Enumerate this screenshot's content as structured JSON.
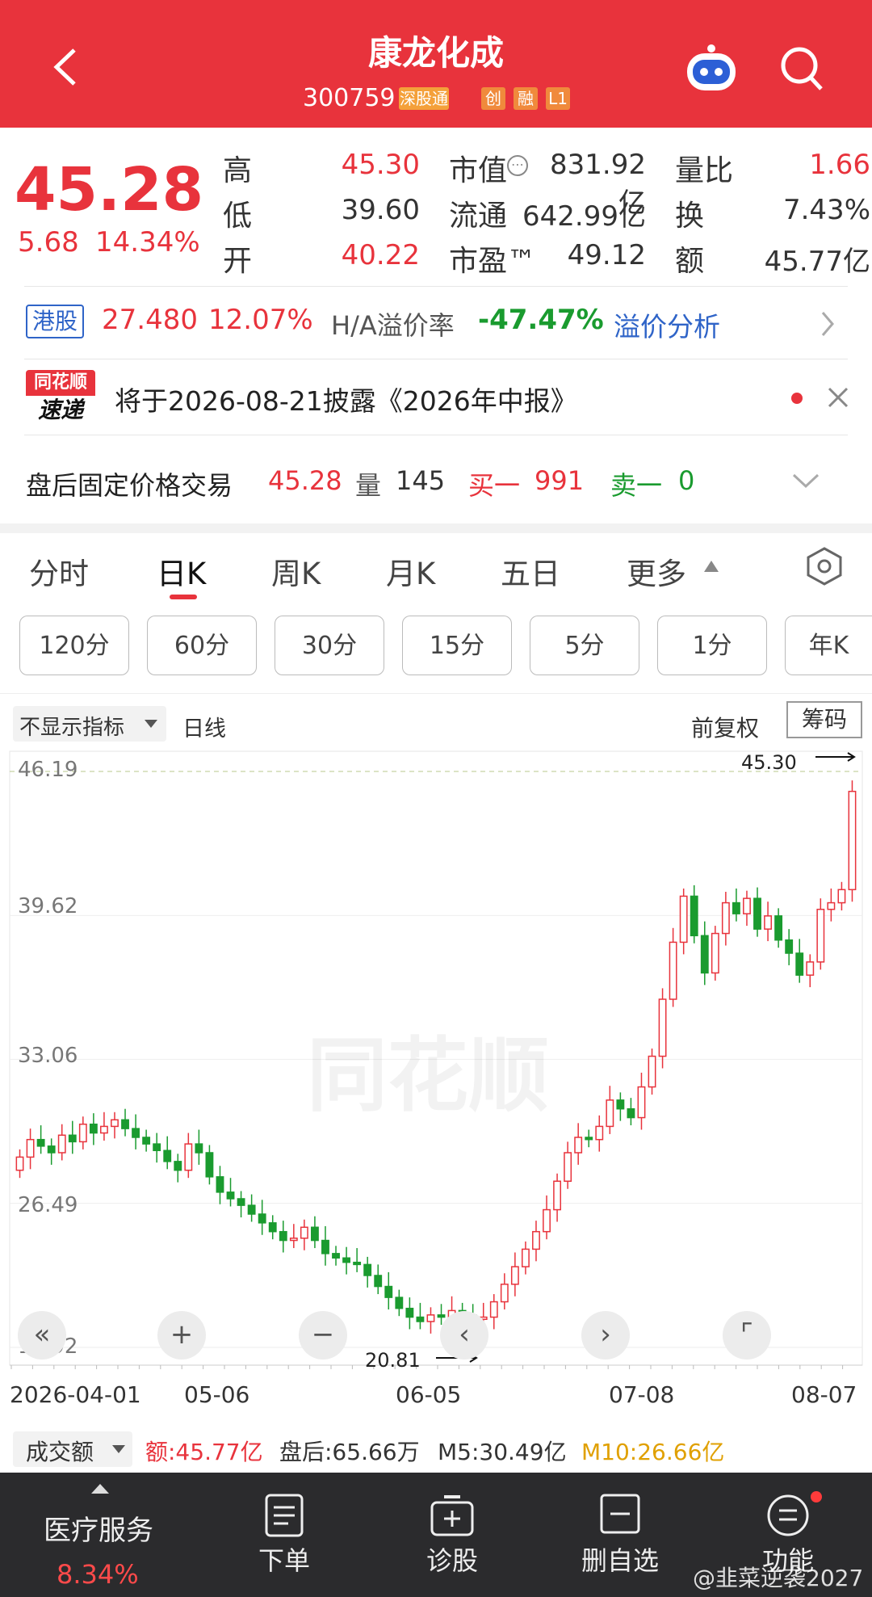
{
  "header": {
    "title": "康龙化成",
    "code": "300759",
    "tags": [
      "深股通",
      "创",
      "融",
      "L1"
    ]
  },
  "quote": {
    "price": "45.28",
    "change": "5.68",
    "change_pct": "14.34%",
    "high_label": "高",
    "high": "45.30",
    "low_label": "低",
    "low": "39.60",
    "open_label": "开",
    "open": "40.22",
    "mcap_label": "市值",
    "mcap": "831.92亿",
    "float_label": "流通",
    "float": "642.99亿",
    "pe_label": "市盈™",
    "pe": "49.12",
    "vr_label": "量比",
    "vr": "1.66",
    "turnover_label": "换",
    "turnover": "7.43%",
    "amount_label": "额",
    "amount": "45.77亿"
  },
  "hk": {
    "badge": "港股",
    "price": "27.480",
    "pct": "12.07%",
    "premium_label": "H/A溢价率",
    "premium": "-47.47%",
    "link": "溢价分析"
  },
  "news": {
    "logo_top": "同花顺",
    "logo_bottom": "速递",
    "text": "将于2026-08-21披露《2026年中报》"
  },
  "afterhours": {
    "label": "盘后固定价格交易",
    "price": "45.28",
    "vol_label": "量",
    "vol": "145",
    "buy_label": "买一",
    "buy": "991",
    "sell_label": "卖一",
    "sell": "0"
  },
  "tabs": [
    "分时",
    "日K",
    "周K",
    "月K",
    "五日",
    "更多"
  ],
  "intervals": [
    "120分",
    "60分",
    "30分",
    "15分",
    "5分",
    "1分",
    "年K"
  ],
  "chart_toolbar": {
    "indicator": "不显示指标",
    "period": "日线",
    "adjust": "前复权",
    "chips": "筹码"
  },
  "chart_data": {
    "type": "candlestick",
    "title": "",
    "y_ticks": [
      "46.19",
      "39.62",
      "33.06",
      "26.49",
      "19.92"
    ],
    "ylim": [
      19.92,
      46.19
    ],
    "x_ticks": [
      "2026-04-01",
      "05-06",
      "06-05",
      "07-08",
      "08-07"
    ],
    "max_label": "45.30",
    "min_label": "20.81",
    "watermark": "同花顺",
    "closes": [
      28.6,
      29.4,
      29.1,
      28.8,
      29.6,
      29.3,
      30.1,
      29.7,
      30.0,
      30.3,
      29.9,
      29.5,
      29.2,
      28.9,
      28.4,
      28.0,
      29.2,
      28.8,
      27.7,
      27.0,
      26.7,
      26.4,
      26.0,
      25.6,
      25.2,
      24.8,
      24.9,
      25.4,
      24.8,
      24.2,
      24.0,
      23.8,
      23.7,
      23.2,
      22.7,
      22.2,
      21.7,
      21.3,
      21.1,
      21.4,
      21.3,
      21.6,
      21.4,
      21.2,
      21.3,
      22.0,
      22.8,
      23.6,
      24.4,
      25.2,
      26.2,
      27.5,
      28.8,
      29.5,
      29.4,
      30.0,
      31.2,
      30.8,
      30.4,
      31.8,
      33.2,
      35.8,
      38.4,
      40.5,
      38.7,
      37.0,
      38.8,
      40.2,
      39.7,
      40.4,
      39.0,
      39.6,
      38.5,
      37.9,
      36.9,
      37.5,
      39.9,
      40.2,
      40.8,
      45.28
    ],
    "bar_labels": {
      "amount": "额:45.77亿",
      "after": "盘后:65.66万",
      "m5": "M5:30.49亿",
      "m10": "M10:26.66亿",
      "selector": "成交额"
    }
  },
  "bottom_nav": {
    "sector": "医疗服务",
    "sector_pct": "8.34%",
    "items": [
      "下单",
      "诊股",
      "删自选",
      "功能"
    ],
    "watermark": "@韭菜逆袭2027"
  },
  "colors": {
    "up": "#e8333c",
    "down": "#1a9b2f",
    "header": "#e8333c"
  }
}
